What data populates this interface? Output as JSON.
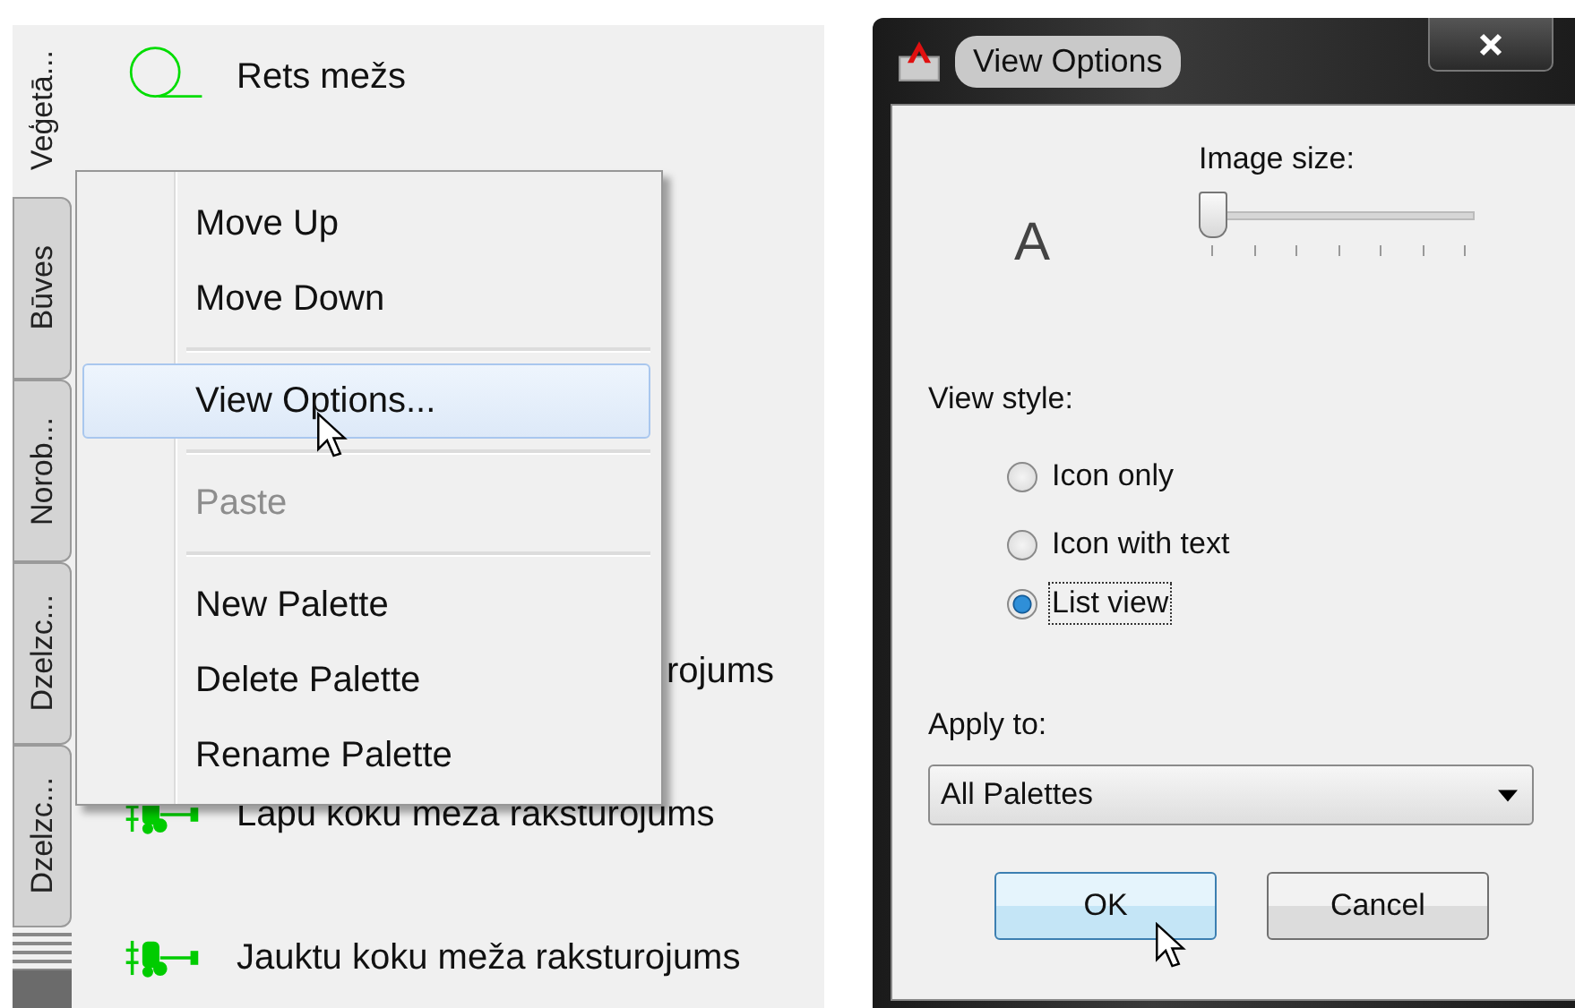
{
  "palette": {
    "tabs": [
      {
        "label": "Veģetā...",
        "selected": true
      },
      {
        "label": "Būves",
        "selected": false
      },
      {
        "label": "Norob...",
        "selected": false
      },
      {
        "label": "Dzelzc...",
        "selected": false
      },
      {
        "label": "Dzelzc...",
        "selected": false
      }
    ],
    "items": [
      {
        "kind": "circle",
        "label": "Rets mežs"
      },
      {
        "kind": "plain",
        "label": "rojums"
      },
      {
        "kind": "trees",
        "label": "Lapu koku meža raksturojums"
      },
      {
        "kind": "trees",
        "label": "Jauktu koku meža raksturojums"
      }
    ]
  },
  "context_menu": {
    "items": [
      {
        "kind": "item",
        "label": "Move Up",
        "selected": false,
        "disabled": false
      },
      {
        "kind": "item",
        "label": "Move Down",
        "selected": false,
        "disabled": false
      },
      {
        "kind": "separator"
      },
      {
        "kind": "item",
        "label": "View Options...",
        "selected": true,
        "disabled": false
      },
      {
        "kind": "separator"
      },
      {
        "kind": "item",
        "label": "Paste",
        "selected": false,
        "disabled": true
      },
      {
        "kind": "separator"
      },
      {
        "kind": "item",
        "label": "New Palette",
        "selected": false,
        "disabled": false
      },
      {
        "kind": "item",
        "label": "Delete Palette",
        "selected": false,
        "disabled": false
      },
      {
        "kind": "item",
        "label": "Rename Palette",
        "selected": false,
        "disabled": false
      }
    ]
  },
  "dialog": {
    "title": "View Options",
    "image_size_label": "Image size:",
    "preview": "A",
    "slider": {
      "level": 0
    },
    "view_style_label": "View style:",
    "options": [
      {
        "label": "Icon only",
        "selected": false,
        "focused": false
      },
      {
        "label": "Icon with text",
        "selected": false,
        "focused": false
      },
      {
        "label": "List view",
        "selected": true,
        "focused": true
      }
    ],
    "apply_to_label": "Apply to:",
    "apply_to": "All Palettes",
    "buttons": [
      {
        "label": "OK",
        "default": true
      },
      {
        "label": "Cancel",
        "default": false
      }
    ]
  }
}
